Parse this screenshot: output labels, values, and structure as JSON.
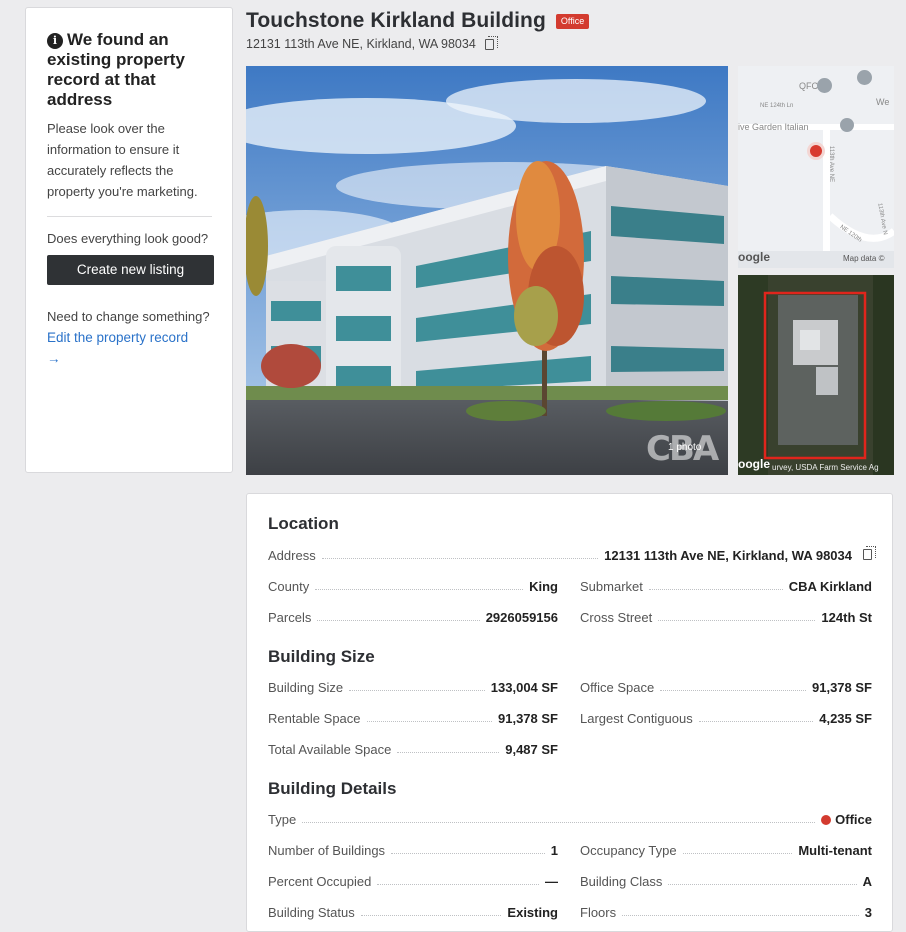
{
  "side": {
    "title": "We found an existing property record at that address",
    "info_icon": "i",
    "body": "Please look over the information to ensure it accurately reflects the property you're marketing.",
    "question": "Does everything look good?",
    "create_button": "Create new listing",
    "change_question": "Need to change something?",
    "edit_link": "Edit the property record",
    "edit_arrow": "→"
  },
  "header": {
    "title": "Touchstone Kirkland Building",
    "badge": "Office",
    "address": "12131 113th Ave NE, Kirkland, WA 98034"
  },
  "media": {
    "photo_count": "1 photo",
    "photo_watermark": "CBA",
    "map_labels": {
      "qfc": "QFC",
      "we": "We",
      "street_124": "NE 124th Ln",
      "olive_garden": "ive Garden Italian",
      "ave_ne": "113th Ave NE",
      "ne_120th": "NE 120th",
      "ave_ne_2": "113th Ave N",
      "google": "oogle",
      "map_data": "Map data ©"
    },
    "satellite_google": "oogle",
    "satellite_credit": "urvey, USDA Farm Service Ag"
  },
  "details": {
    "location_heading": "Location",
    "address_label": "Address",
    "address_value": "12131 113th Ave NE, Kirkland, WA 98034",
    "county_label": "County",
    "county_value": "King",
    "submarket_label": "Submarket",
    "submarket_value": "CBA Kirkland",
    "parcels_label": "Parcels",
    "parcels_value": "2926059156",
    "cross_street_label": "Cross Street",
    "cross_street_value": "124th St",
    "size_heading": "Building Size",
    "building_size_label": "Building Size",
    "building_size_value": "133,004 SF",
    "office_space_label": "Office Space",
    "office_space_value": "91,378 SF",
    "rentable_label": "Rentable Space",
    "rentable_value": "91,378 SF",
    "largest_label": "Largest Contiguous",
    "largest_value": "4,235 SF",
    "available_label": "Total Available Space",
    "available_value": "9,487 SF",
    "details_heading": "Building Details",
    "type_label": "Type",
    "type_value": "Office",
    "num_buildings_label": "Number of Buildings",
    "num_buildings_value": "1",
    "occupancy_label": "Occupancy Type",
    "occupancy_value": "Multi-tenant",
    "percent_label": "Percent Occupied",
    "percent_value": "—",
    "class_label": "Building Class",
    "class_value": "A",
    "status_label": "Building Status",
    "status_value": "Existing",
    "floors_label": "Floors",
    "floors_value": "3"
  },
  "colors": {
    "accent_red": "#d33b2f",
    "link_blue": "#2a72c9",
    "button_dark": "#2f3235"
  },
  "icons": [
    "info-icon",
    "copy-icon",
    "map-pin-icon",
    "status-dot-icon"
  ]
}
